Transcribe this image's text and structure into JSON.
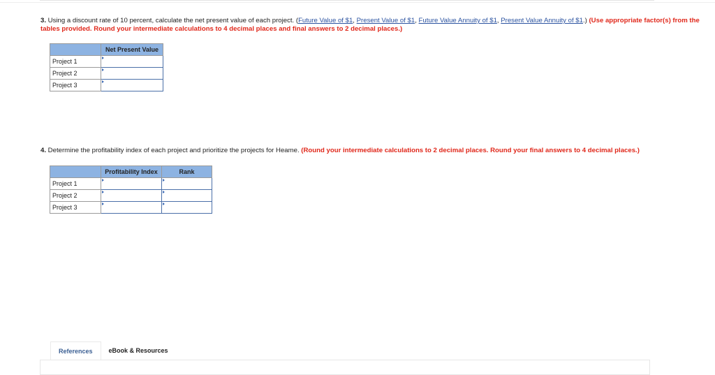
{
  "q3": {
    "number": "3.",
    "text": " Using a discount rate of 10 percent, calculate the net present value of each project. (",
    "links": [
      "Future Value of $1",
      "Present Value of $1",
      "Future Value Annuity of $1",
      "Present Value Annuity of $1"
    ],
    "sep": ", ",
    "after_links": ".) ",
    "instruction": "(Use appropriate factor(s) from the tables provided. Round your intermediate calculations to 4 decimal places and final answers to 2 decimal places.)",
    "table": {
      "header": "Net Present Value",
      "rows": [
        "Project 1",
        "Project 2",
        "Project 3"
      ],
      "values": [
        "",
        "",
        ""
      ]
    }
  },
  "q4": {
    "number": "4.",
    "text": " Determine the profitability index of each project and prioritize the projects for Heame. ",
    "instruction": "(Round your intermediate calculations to 2 decimal places. Round your final answers to 4 decimal places.)",
    "table": {
      "headers": [
        "Profitability Index",
        "Rank"
      ],
      "rows": [
        "Project 1",
        "Project 2",
        "Project 3"
      ],
      "pi_values": [
        "",
        "",
        ""
      ],
      "rank_values": [
        "",
        "",
        ""
      ]
    }
  },
  "tabs": [
    {
      "label": "References",
      "active": true
    },
    {
      "label": "eBook & Resources",
      "active": false
    }
  ]
}
